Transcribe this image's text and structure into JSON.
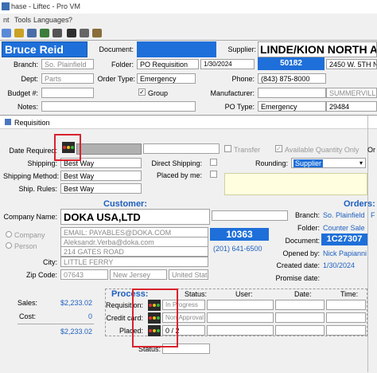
{
  "window": {
    "title": "hase - Liftec - Pro VM",
    "menu": [
      "nt",
      "Tools",
      "Languages",
      "?"
    ]
  },
  "header": {
    "customer_name": "Bruce Reid",
    "document_label": "Document:",
    "document_value": "",
    "supplier_label": "Supplier:",
    "supplier_value": "LINDE/KION NORTH A",
    "branch_label": "Branch:",
    "branch_value": "So. Plainfield",
    "folder_label": "Folder:",
    "folder_value": "PO Requisition",
    "folder_date": "1/30/2024",
    "supplier_number": "50182",
    "supplier_address": "2450 W. 5TH N",
    "dept_label": "Dept:",
    "dept_value": "Parts",
    "order_type_label": "Order Type:",
    "order_type_value": "Emergency",
    "phone_label": "Phone:",
    "phone_value": "(843) 875-8000",
    "budget_label": "Budget #:",
    "budget_value": "",
    "group_label": "Group",
    "group_checked": true,
    "manufacturer_label": "Manufacturer:",
    "manufacturer_value": "",
    "manufacturer_city": "SUMMERVILLE",
    "notes_label": "Notes:",
    "notes_value": "",
    "po_type_label": "PO Type:",
    "po_type_value": "Emergency",
    "po_zip": "29484"
  },
  "requisition": {
    "title": "Requisition",
    "date_required_label": "Date Required:",
    "transfer_label": "Transfer",
    "available_qty_label": "Available Quantity Only",
    "available_qty_checked": true,
    "order_cut": "Or",
    "shipping_label": "Shipping:",
    "shipping_value": "Best Way",
    "direct_shipping_label": "Direct Shipping:",
    "shipping_method_label": "Shipping Method:",
    "shipping_method_value": "Best Way",
    "placed_by_label": "Placed by me:",
    "ship_rules_label": "Ship. Rules:",
    "ship_rules_value": "Best Way",
    "rounding_label": "Rounding:",
    "rounding_value": "Supplier"
  },
  "customer": {
    "heading": "Customer:",
    "company_name_label": "Company Name:",
    "company_name_value": "DOKA USA,LTD",
    "company_radio": "Company",
    "person_radio": "Person",
    "email": "EMAIL: PAYABLES@DOKA.COM",
    "contact": "Aleksandr.Verba@doka.com",
    "address": "214 GATES ROAD",
    "number": "10363",
    "phone": "(201) 641-6500",
    "city_label": "City:",
    "city_value": "LITTLE FERRY",
    "zip_label": "Zip Code:",
    "zip_value": "07643",
    "state_value": "New Jersey",
    "country_value": "United State"
  },
  "orders": {
    "heading": "Orders:",
    "branch_label": "Branch:",
    "branch_value": "So. Plainfield",
    "folder_label": "Folder:",
    "folder_value": "Counter Sale",
    "document_label": "Document:",
    "document_value": "1C27307",
    "opened_by_label": "Opened by:",
    "opened_by_value": "Nick Papianni",
    "created_date_label": "Created date:",
    "created_date_value": "1/30/2024",
    "promise_date_label": "Promise date:",
    "promise_date_value": ""
  },
  "totals": {
    "sales_label": "Sales:",
    "sales_value": "$2,233.02",
    "cost_label": "Cost:",
    "cost_value": "0",
    "third_value": "$2,233.02"
  },
  "process": {
    "heading": "Process:",
    "col_status": "Status:",
    "col_user": "User:",
    "col_date": "Date:",
    "col_time": "Time:",
    "rows": [
      {
        "label": "Requisition:",
        "status": "In Progress"
      },
      {
        "label": "Credit card:",
        "status": "Non Approval"
      },
      {
        "label": "Placed:",
        "status": "0 / 2"
      }
    ],
    "footer_status_label": "Status:"
  },
  "colors": {
    "accent_blue": "#1e6fd9",
    "highlight_red": "#d9232e"
  }
}
